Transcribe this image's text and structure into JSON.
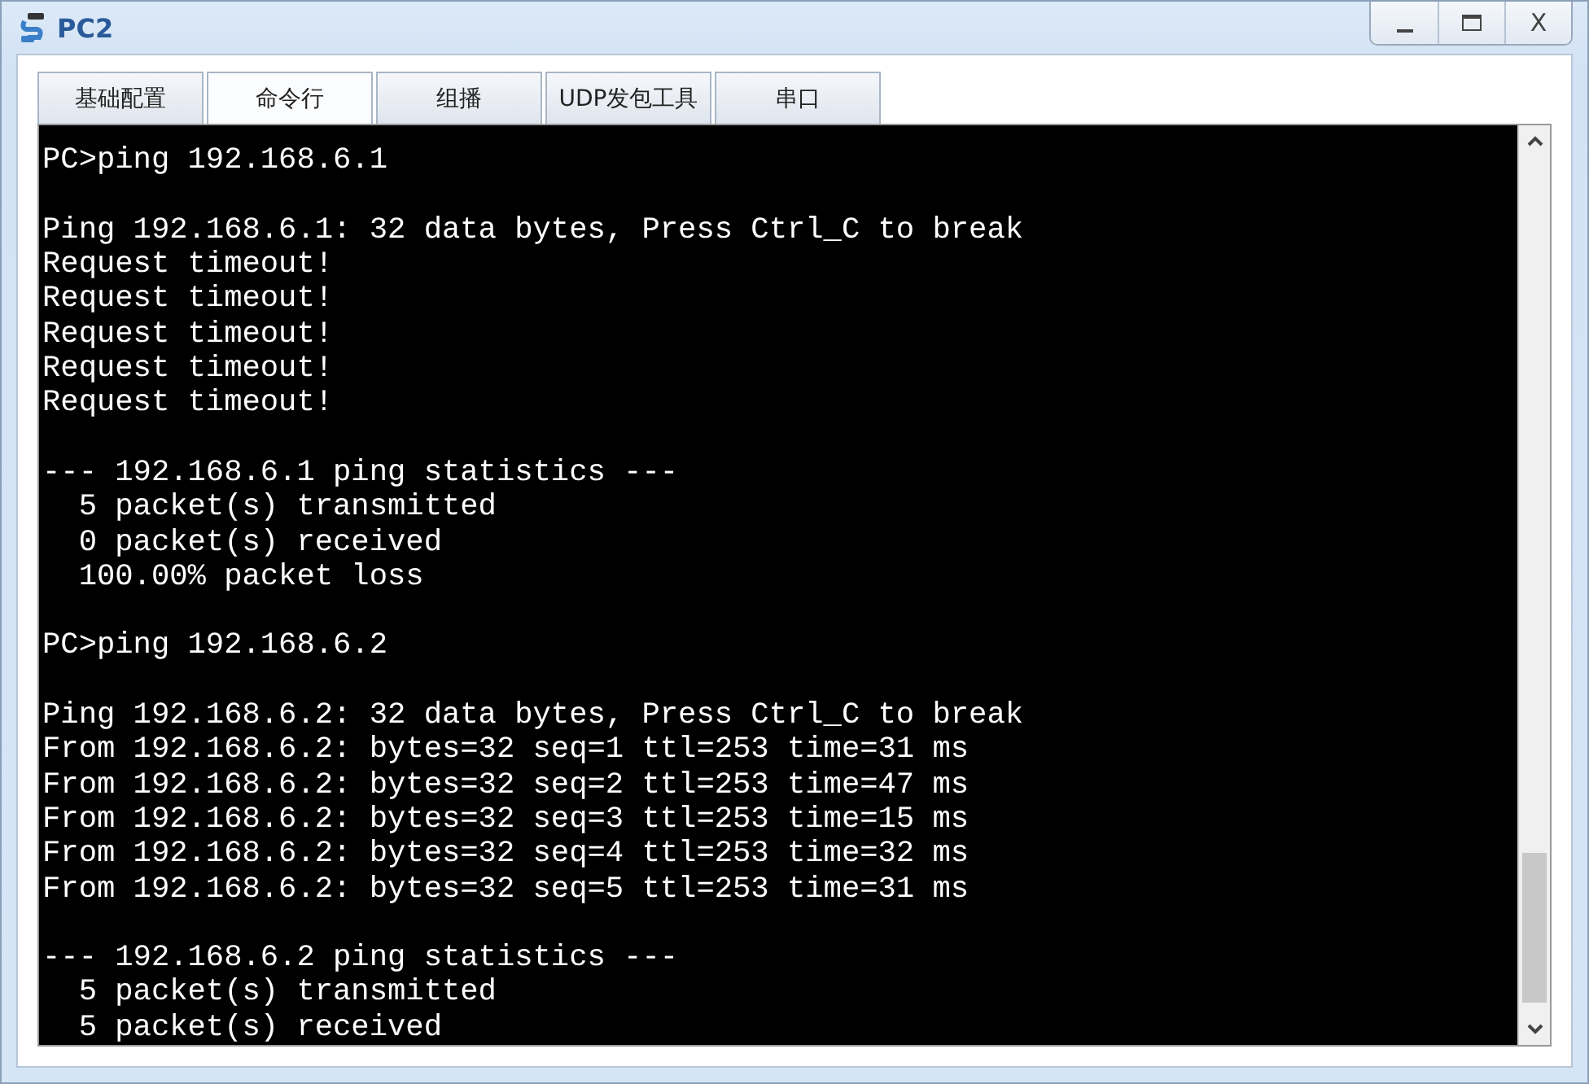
{
  "window": {
    "title": "PC2",
    "close_label": "X"
  },
  "tabs": [
    {
      "label": "基础配置",
      "selected": false
    },
    {
      "label": "命令行",
      "selected": true
    },
    {
      "label": "组播",
      "selected": false
    },
    {
      "label": "UDP发包工具",
      "selected": false
    },
    {
      "label": "串口",
      "selected": false
    }
  ],
  "terminal": {
    "blocks": [
      [
        "PC>ping 192.168.6.1"
      ],
      [
        "Ping 192.168.6.1: 32 data bytes, Press Ctrl_C to break",
        "Request timeout!",
        "Request timeout!",
        "Request timeout!",
        "Request timeout!",
        "Request timeout!"
      ],
      [
        "--- 192.168.6.1 ping statistics ---",
        "  5 packet(s) transmitted",
        "  0 packet(s) received",
        "  100.00% packet loss"
      ],
      [
        "PC>ping 192.168.6.2"
      ],
      [
        "Ping 192.168.6.2: 32 data bytes, Press Ctrl_C to break",
        "From 192.168.6.2: bytes=32 seq=1 ttl=253 time=31 ms",
        "From 192.168.6.2: bytes=32 seq=2 ttl=253 time=47 ms",
        "From 192.168.6.2: bytes=32 seq=3 ttl=253 time=15 ms",
        "From 192.168.6.2: bytes=32 seq=4 ttl=253 time=32 ms",
        "From 192.168.6.2: bytes=32 seq=5 ttl=253 time=31 ms"
      ],
      [
        "--- 192.168.6.2 ping statistics ---",
        "  5 packet(s) transmitted",
        "  5 packet(s) received"
      ]
    ]
  }
}
